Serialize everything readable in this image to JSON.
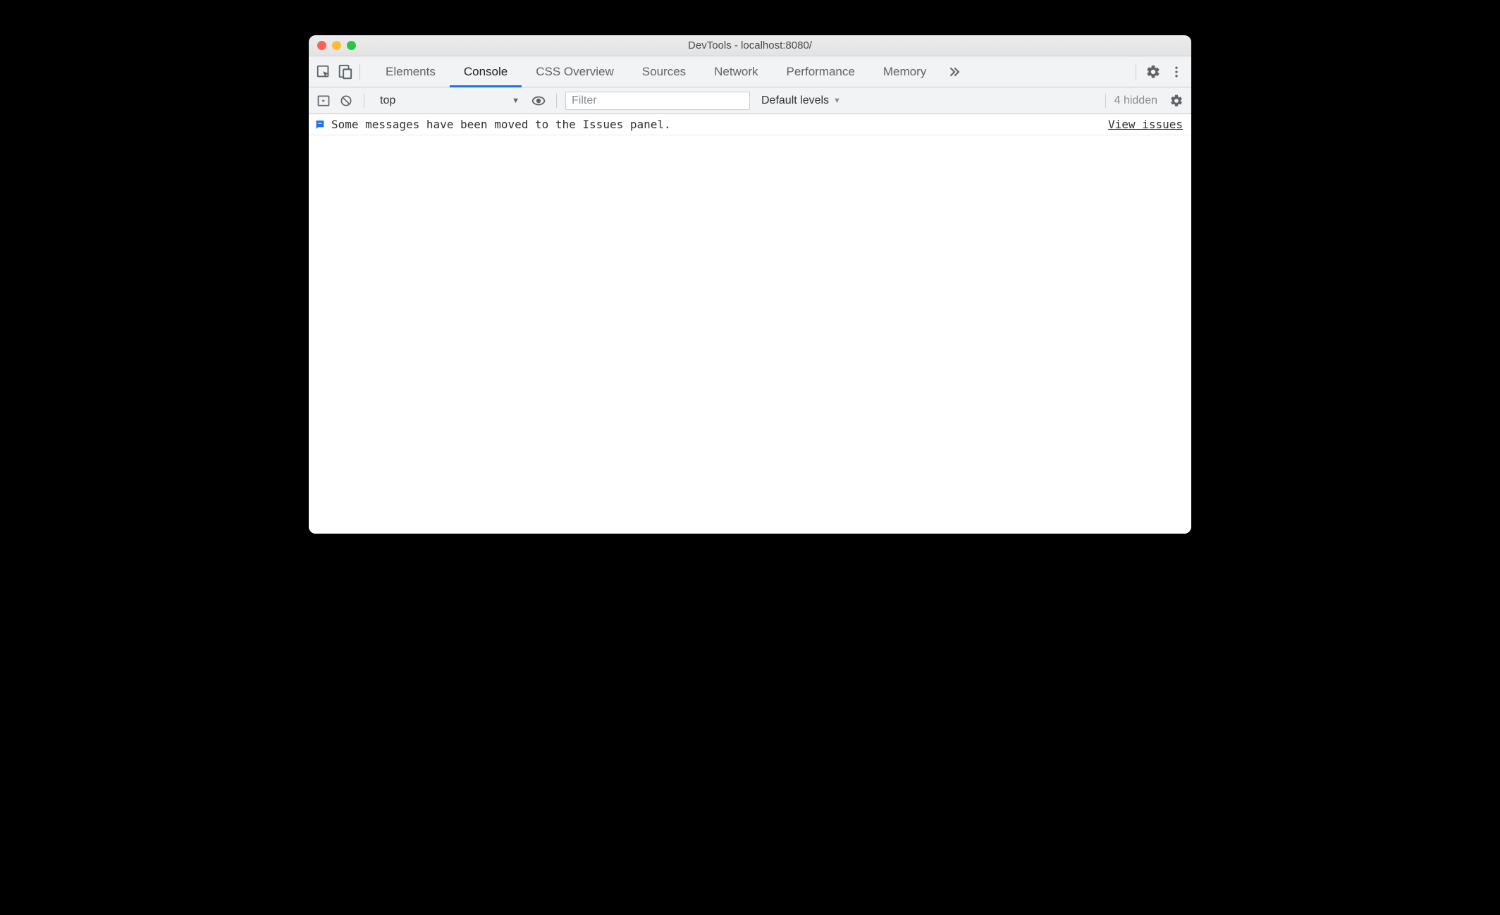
{
  "window": {
    "title": "DevTools - localhost:8080/"
  },
  "tabs": {
    "items": [
      "Elements",
      "Console",
      "CSS Overview",
      "Sources",
      "Network",
      "Performance",
      "Memory"
    ],
    "active": "Console"
  },
  "console_toolbar": {
    "context": "top",
    "filter_placeholder": "Filter",
    "levels_label": "Default levels",
    "hidden_text": "4 hidden"
  },
  "message": {
    "text": "Some messages have been moved to the Issues panel.",
    "link": "View issues"
  }
}
